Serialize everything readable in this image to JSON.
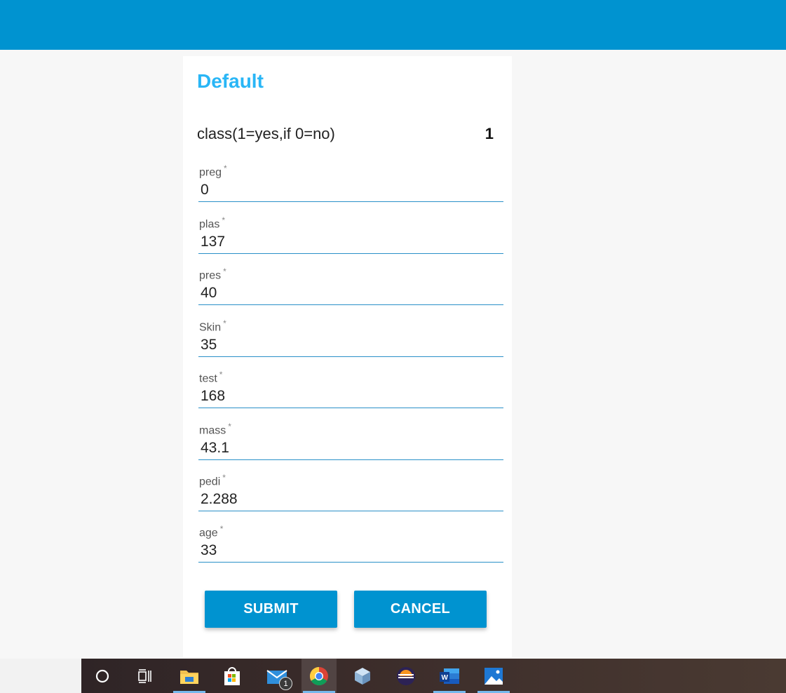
{
  "form": {
    "title": "Default",
    "class_label": "class(1=yes,if 0=no)",
    "class_value": "1",
    "required_marker": "*",
    "fields": [
      {
        "label": "preg",
        "value": "0"
      },
      {
        "label": "plas",
        "value": "137"
      },
      {
        "label": "pres",
        "value": "40"
      },
      {
        "label": "Skin",
        "value": "35"
      },
      {
        "label": "test",
        "value": "168"
      },
      {
        "label": "mass",
        "value": "43.1"
      },
      {
        "label": "pedi",
        "value": "2.288"
      },
      {
        "label": "age",
        "value": "33"
      }
    ],
    "submit_label": "SUBMIT",
    "cancel_label": "CANCEL"
  },
  "taskbar": {
    "items": [
      {
        "name": "cortana-search",
        "icon": "circle-icon"
      },
      {
        "name": "task-view",
        "icon": "task-view-icon"
      },
      {
        "name": "file-explorer",
        "icon": "folder-icon"
      },
      {
        "name": "microsoft-store",
        "icon": "store-bag-icon"
      },
      {
        "name": "mail",
        "icon": "mail-icon",
        "badge": "1"
      },
      {
        "name": "chrome",
        "icon": "chrome-icon"
      },
      {
        "name": "virtualbox",
        "icon": "cube-icon"
      },
      {
        "name": "eclipse",
        "icon": "eclipse-icon"
      },
      {
        "name": "word",
        "icon": "word-icon"
      },
      {
        "name": "photos",
        "icon": "photos-icon"
      }
    ],
    "mail_badge": "1"
  },
  "colors": {
    "header": "#0093d0",
    "title": "#29b6f6",
    "button": "#0093d0",
    "field_underline": "#2a90c8"
  }
}
